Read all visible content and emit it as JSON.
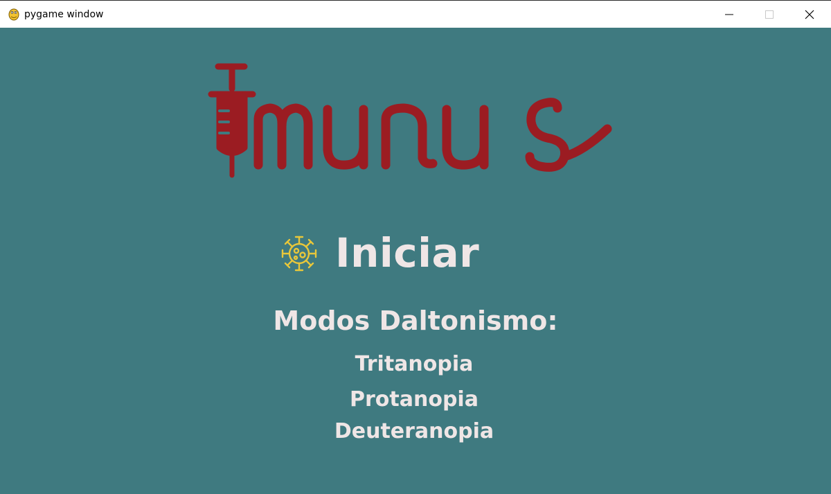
{
  "window": {
    "title": "pygame window",
    "app_icon": "pygame-snake-icon",
    "controls": {
      "minimize_icon": "minimize-icon",
      "maximize_icon": "maximize-icon",
      "close_icon": "close-icon"
    }
  },
  "colors": {
    "background": "#3f7a80",
    "logo": "#9b1c22",
    "text": "#efe6e6",
    "virus_icon": "#e8c73a"
  },
  "logo": {
    "text": "Imunus",
    "icon": "syringe-icon"
  },
  "menu": {
    "start_icon": "virus-icon",
    "start_label": "Iniciar",
    "modes_heading": "Modos Daltonismo:",
    "modes": [
      "Tritanopia",
      "Protanopia",
      "Deuteranopia"
    ]
  }
}
